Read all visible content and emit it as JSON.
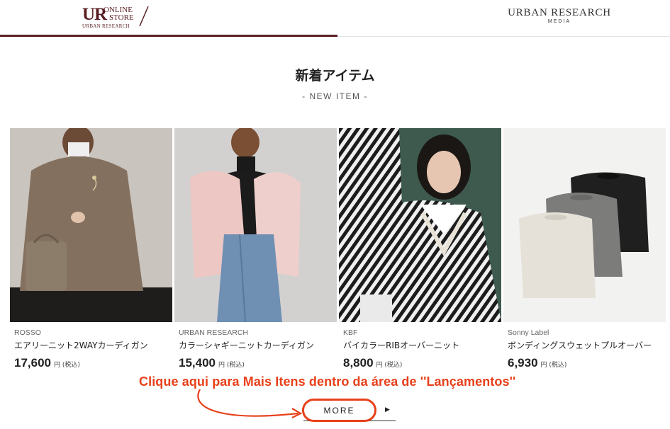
{
  "header": {
    "left_tab": {
      "logo_mark": "UR",
      "logo_line1": "ONLINE",
      "logo_line2": "STORE",
      "logo_sub": "URBAN RESEARCH"
    },
    "right_tab": {
      "title": "URBAN RESEARCH",
      "subtitle": "MEDIA"
    },
    "accent_color": "#5a1f23"
  },
  "section": {
    "title": "新着アイテム",
    "subtitle": "- NEW ITEM -"
  },
  "products": [
    {
      "brand": "ROSSO",
      "name": "エアリーニット2WAYカーディガン",
      "price": "17,600",
      "unit": "円 (税込)"
    },
    {
      "brand": "URBAN RESEARCH",
      "name": "カラーシャギーニットカーディガン",
      "price": "15,400",
      "unit": "円 (税込)"
    },
    {
      "brand": "KBF",
      "name": "バイカラーRIBオーバーニット",
      "price": "8,800",
      "unit": "円 (税込)"
    },
    {
      "brand": "Sonny Label",
      "name": "ボンディングスウェットプルオーバー",
      "price": "6,930",
      "unit": "円 (税込)"
    }
  ],
  "annotation": {
    "text": "Clique aqui para Mais Itens dentro da área de ''Lançamentos''",
    "color": "#e8401a"
  },
  "more_button": {
    "label": "MORE",
    "arrow_icon": "triangle-right-icon"
  }
}
